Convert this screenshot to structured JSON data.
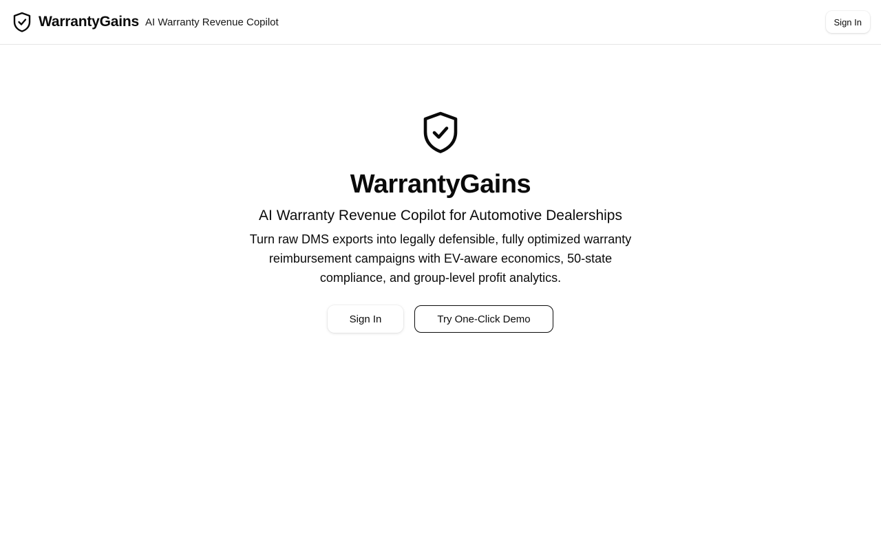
{
  "header": {
    "brand_name": "WarrantyGains",
    "brand_tagline": "AI Warranty Revenue Copilot",
    "logo_icon": "shield-check-icon",
    "sign_in_label": "Sign In"
  },
  "hero": {
    "logo_icon": "shield-check-icon",
    "title": "WarrantyGains",
    "subtitle": "AI Warranty Revenue Copilot for Automotive Dealerships",
    "description": "Turn raw DMS exports into legally defensible, fully optimized warranty reimbursement campaigns with EV-aware economics, 50-state compliance, and group-level profit analytics.",
    "primary_button_label": "Sign In",
    "secondary_button_label": "Try One-Click Demo"
  },
  "colors": {
    "text": "#0a0a0a",
    "background": "#ffffff",
    "border": "#e5e5e5"
  }
}
